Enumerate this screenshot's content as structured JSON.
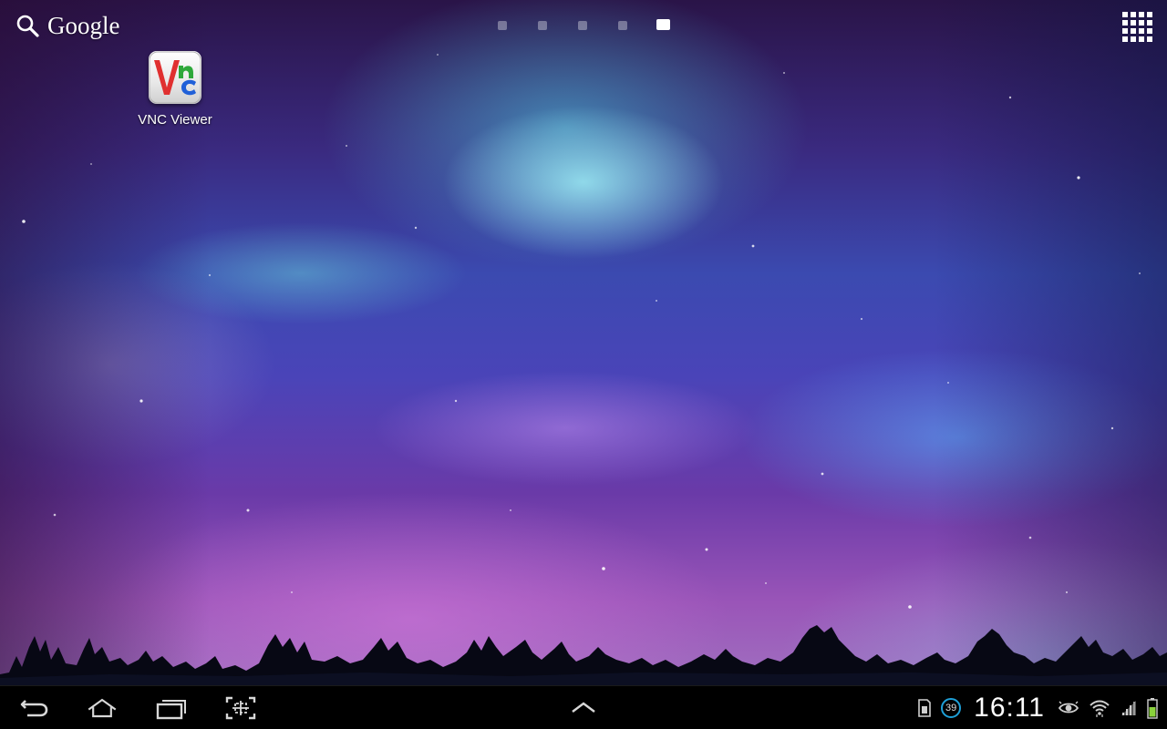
{
  "search": {
    "label": "Google"
  },
  "pages": {
    "count": 5,
    "active_index": 4
  },
  "desktop": {
    "shortcuts": [
      {
        "label": "VNC Viewer",
        "icon": "vnc-viewer-icon"
      }
    ]
  },
  "status_bar": {
    "time": "16:11",
    "notification_count": "39",
    "icons": [
      "sd-card-icon",
      "notification-count-icon",
      "eye-icon",
      "wifi-icon",
      "signal-icon",
      "battery-icon"
    ]
  },
  "navigation": {
    "buttons": [
      "back-icon",
      "home-icon",
      "recent-apps-icon",
      "screenshot-icon",
      "expand-up-icon"
    ]
  },
  "colors": {
    "accent_blue": "#1ea0d8",
    "battery_green": "#8ad23c",
    "vnc_red": "#e03030",
    "vnc_green": "#2ea83a",
    "vnc_blue": "#2060d8"
  }
}
